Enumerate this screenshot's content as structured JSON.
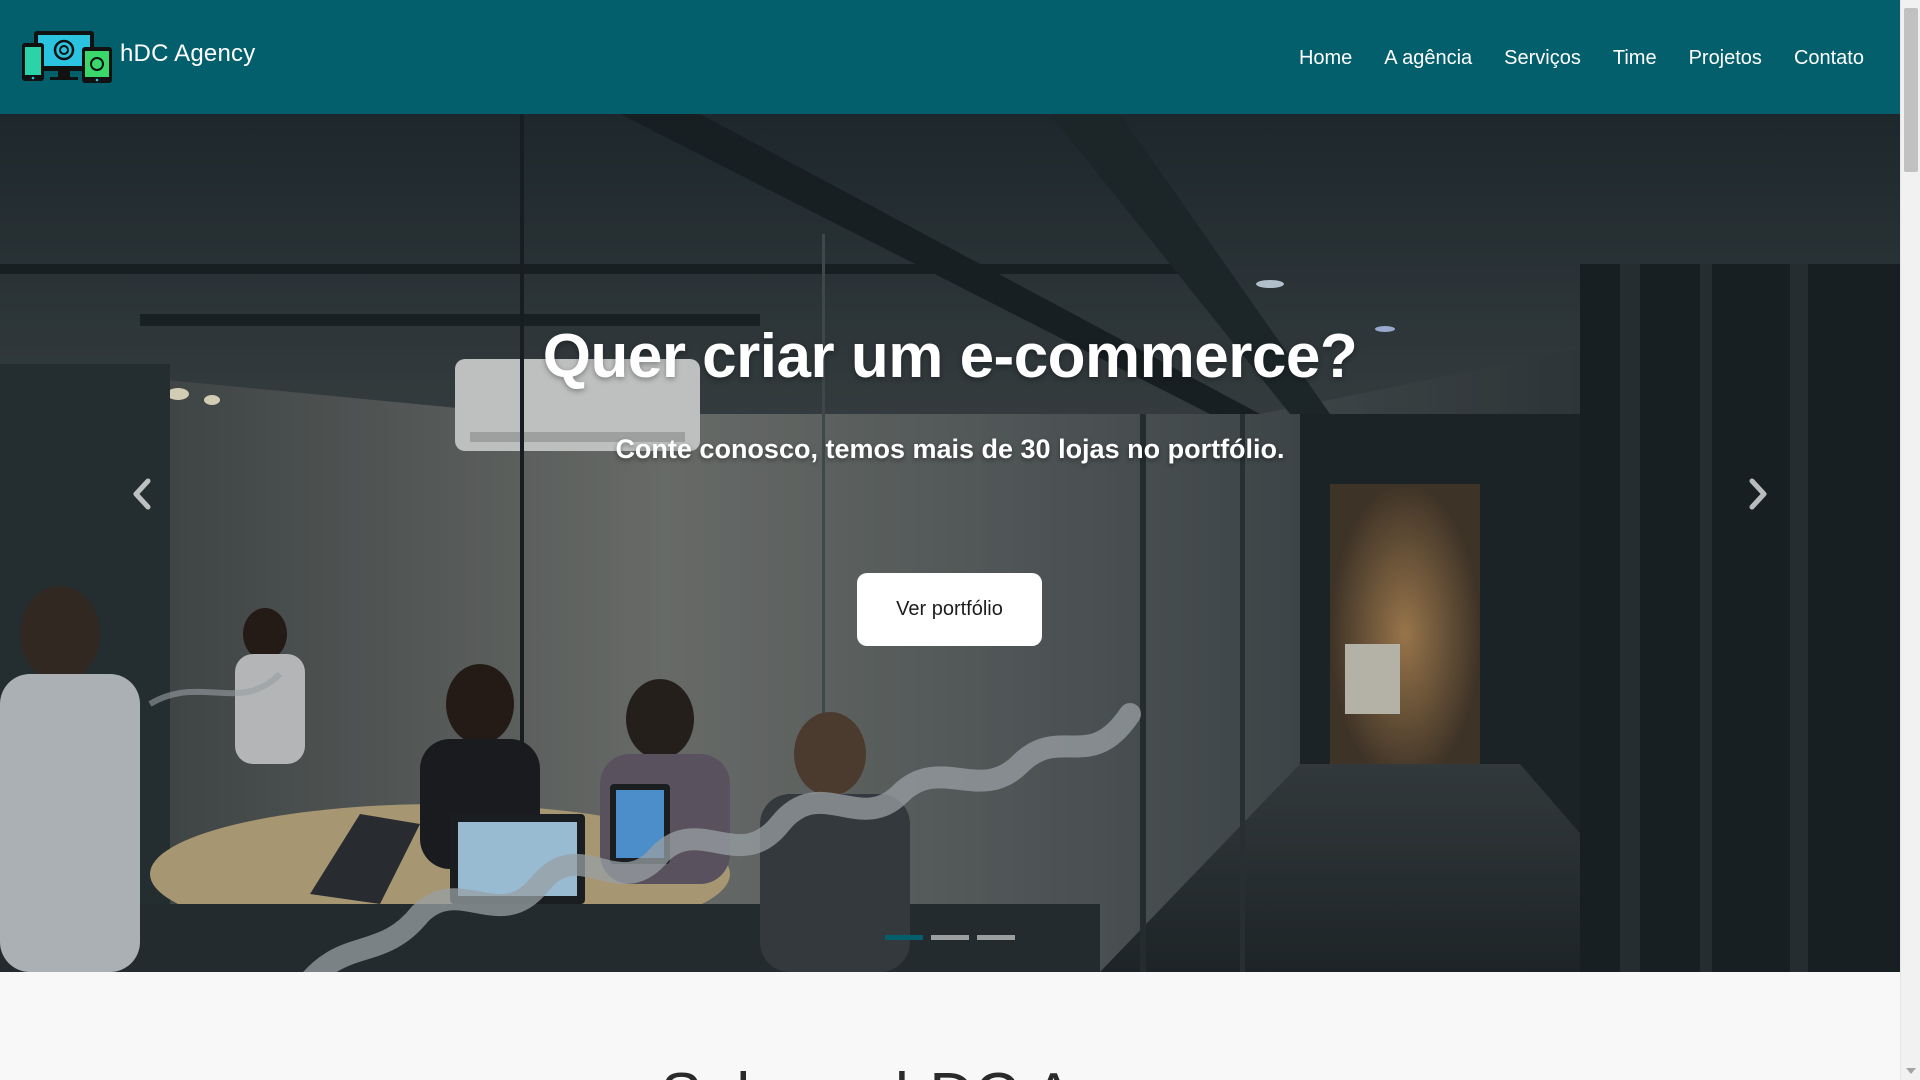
{
  "brand": {
    "name": "hDC Agency",
    "logo_icon": "devices-logo-icon"
  },
  "nav": {
    "items": [
      {
        "label": "Home"
      },
      {
        "label": "A agência"
      },
      {
        "label": "Serviços"
      },
      {
        "label": "Time"
      },
      {
        "label": "Projetos"
      },
      {
        "label": "Contato"
      }
    ]
  },
  "hero": {
    "title": "Quer criar um e-commerce?",
    "subtitle": "Conte conosco, temos mais de 30 lojas no portfólio.",
    "cta_label": "Ver portfólio",
    "prev_icon": "chevron-left-icon",
    "next_icon": "chevron-right-icon",
    "slide_count": 3,
    "active_slide": 1
  },
  "about": {
    "title": "Sobre a hDC Agency"
  },
  "colors": {
    "primary": "#035f6c",
    "white": "#ffffff",
    "page_bg": "#f8f8f8"
  }
}
